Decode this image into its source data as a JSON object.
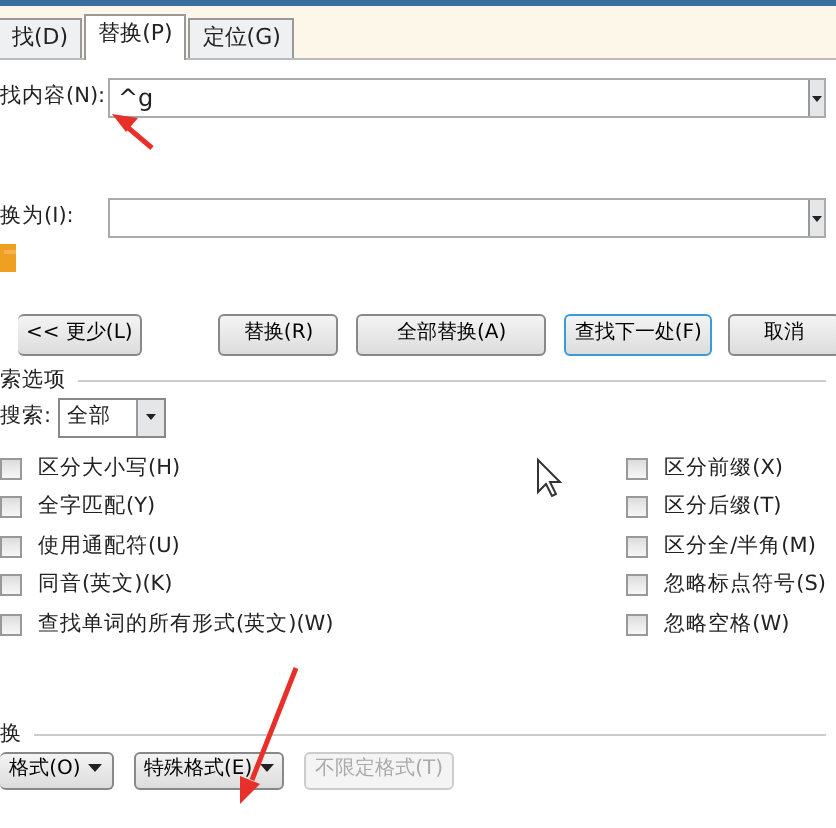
{
  "tabs": [
    {
      "label": "找(D)",
      "selected": false
    },
    {
      "label": "替换(P)",
      "selected": true
    },
    {
      "label": "定位(G)",
      "selected": false
    }
  ],
  "find": {
    "label": "找内容(N):",
    "value": "^g"
  },
  "replace": {
    "label": "换为(I):"
  },
  "action_buttons": [
    {
      "label": "<< 更少(L)",
      "focused": false
    },
    {
      "label": "替换(R)",
      "focused": false
    },
    {
      "label": "全部替换(A)",
      "focused": false
    },
    {
      "label": "查找下一处(F)",
      "focused": true
    },
    {
      "label": "取消",
      "focused": false
    }
  ],
  "search_options": {
    "title": "索选项",
    "search_label": "搜索:",
    "search_value": "全部"
  },
  "options_left": [
    {
      "label": "区分大小写(H)",
      "checked": false
    },
    {
      "label": "全字匹配(Y)",
      "checked": false
    },
    {
      "label": "使用通配符(U)",
      "checked": false
    },
    {
      "label": "同音(英文)(K)",
      "checked": false
    },
    {
      "label": "查找单词的所有形式(英文)(W)",
      "checked": false
    }
  ],
  "options_right": [
    {
      "label": "区分前缀(X)",
      "checked": false
    },
    {
      "label": "区分后缀(T)",
      "checked": false
    },
    {
      "label": "区分全/半角(M)",
      "checked": false
    },
    {
      "label": "忽略标点符号(S)",
      "checked": false
    },
    {
      "label": "忽略空格(W)",
      "checked": false
    }
  ],
  "replace_section": {
    "title": "换"
  },
  "format_buttons": [
    {
      "label": "格式(O)",
      "dropdown": true,
      "disabled": false
    },
    {
      "label": "特殊格式(E)",
      "dropdown": true,
      "disabled": false
    },
    {
      "label": "不限定格式(T)",
      "dropdown": false,
      "disabled": true
    }
  ]
}
